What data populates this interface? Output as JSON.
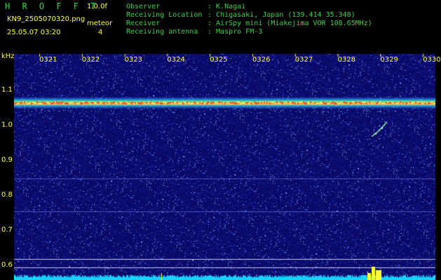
{
  "header": {
    "app_title": "H R O F F T",
    "version": "1.0.0f",
    "filename": "KN9_2505070320.png",
    "timestamp": "25.05.07 03:20",
    "meteor_label": "meteor",
    "meteor_count": "4",
    "info": [
      {
        "label": "Observer",
        "value": ": K.Nagai"
      },
      {
        "label": "Receiving Location",
        "value": ": Chigasaki, Japan (139.414 35.340)"
      },
      {
        "label": "Receiver",
        "value": ": AirSpy mini (Miakejima VOR 108.65MHz)"
      },
      {
        "label": "Receiving antenna",
        "value": ": Maspro FM-3"
      }
    ]
  },
  "spectrogram": {
    "unit_label": "kHz",
    "y_labels": [
      "1.1",
      "1.0",
      "0.9",
      "0.8",
      "0.7",
      "0.6"
    ],
    "time_ticks": [
      "0321",
      "0322",
      "0323",
      "0324",
      "0325",
      "0326",
      "0327",
      "0328",
      "0329",
      "0330"
    ],
    "colors": {
      "background": "#0a0a5a",
      "carrier": "#ff3a2a",
      "label": "#ffff33",
      "info": "#37d24a",
      "spectrum": "#19d0ff"
    }
  }
}
